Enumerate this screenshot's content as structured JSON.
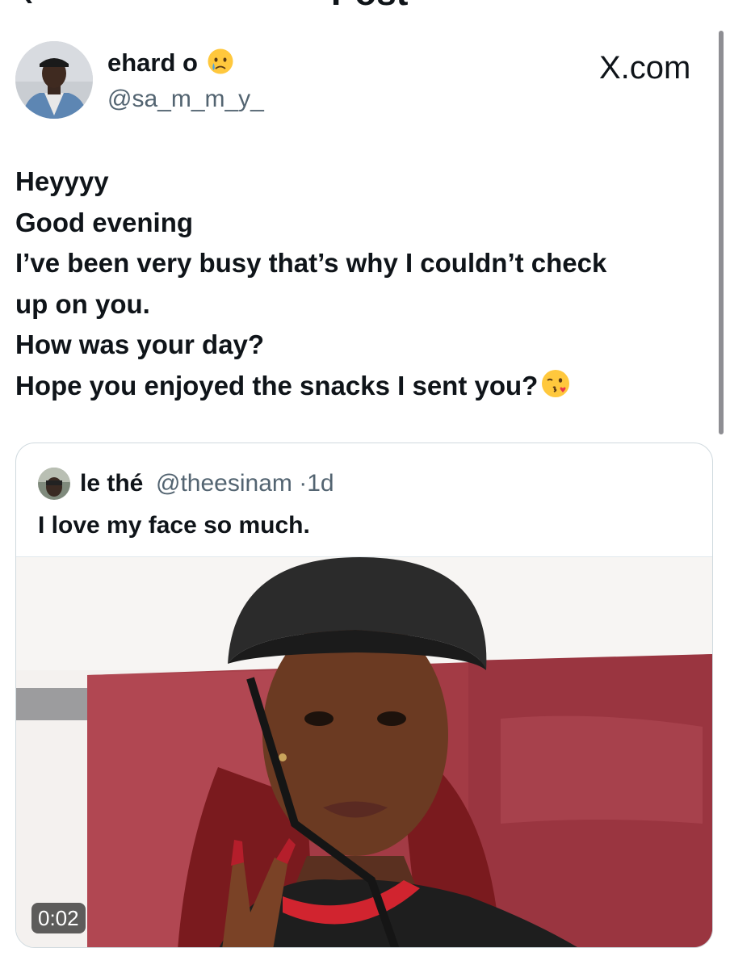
{
  "header": {
    "back_icon": "back-arrow-icon",
    "title": "Post"
  },
  "author": {
    "display_name": "ehard o",
    "name_emoji": "crying-face-emoji",
    "handle": "@sa_m_m_y_"
  },
  "watermark": "X.com",
  "tweet": {
    "lines": [
      "Heyyyy",
      "Good evening",
      "I’ve been very busy that’s why I couldn’t check",
      "up on you.",
      "How was your day?",
      "Hope you enjoyed the snacks I sent you?"
    ],
    "trailing_emoji": "face-blowing-kiss-emoji"
  },
  "quoted_post": {
    "display_name": "le thé",
    "handle": "@theesinam",
    "separator": "·",
    "time": "1d",
    "text": "I love my face so much.",
    "media": {
      "type": "video",
      "duration": "0:02"
    }
  },
  "colors": {
    "text": "#0f1419",
    "secondary": "#536471",
    "border": "#cfd9de",
    "seat": "#a33b45",
    "helmet": "#2b2b2b"
  }
}
